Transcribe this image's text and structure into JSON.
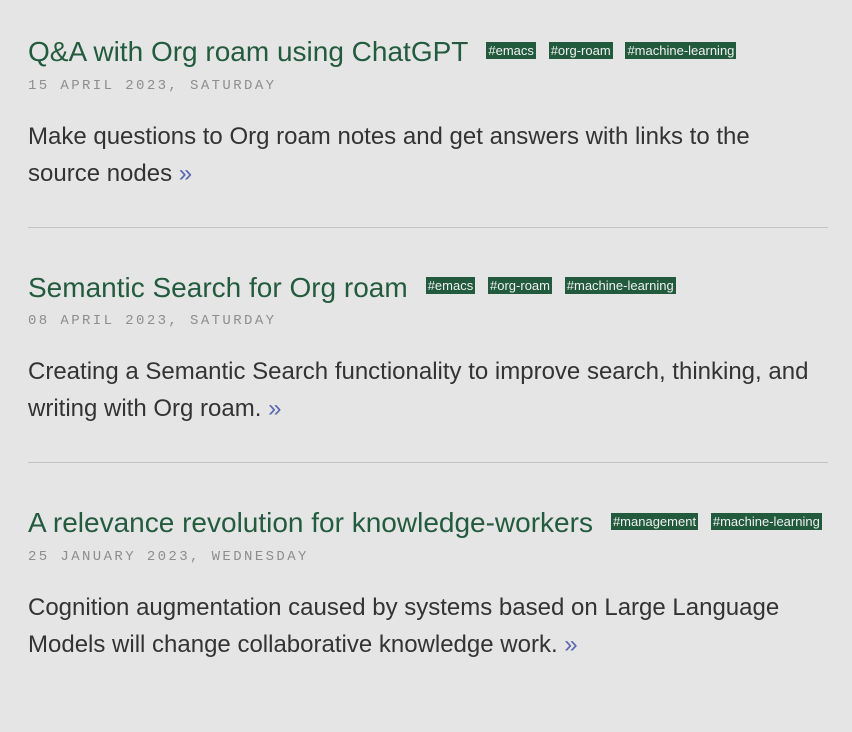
{
  "posts": [
    {
      "title": "Q&A with Org roam using ChatGPT",
      "tags": [
        "#emacs",
        "#org-roam",
        "#machine-learning"
      ],
      "date": "15 APRIL 2023, SATURDAY",
      "description": "Make questions to Org roam notes and get answers with links to the source nodes",
      "more": "»"
    },
    {
      "title": "Semantic Search for Org roam",
      "tags": [
        "#emacs",
        "#org-roam",
        "#machine-learning"
      ],
      "date": "08 APRIL 2023, SATURDAY",
      "description": "Creating a Semantic Search functionality to improve search, thinking, and writing with Org roam.",
      "more": "»"
    },
    {
      "title": "A relevance revolution for knowledge-workers",
      "tags": [
        "#management",
        "#machine-learning"
      ],
      "date": "25 JANUARY 2023, WEDNESDAY",
      "description": "Cognition augmentation caused by systems based on Large Language Models will change collaborative knowledge work.",
      "more": "»"
    }
  ]
}
